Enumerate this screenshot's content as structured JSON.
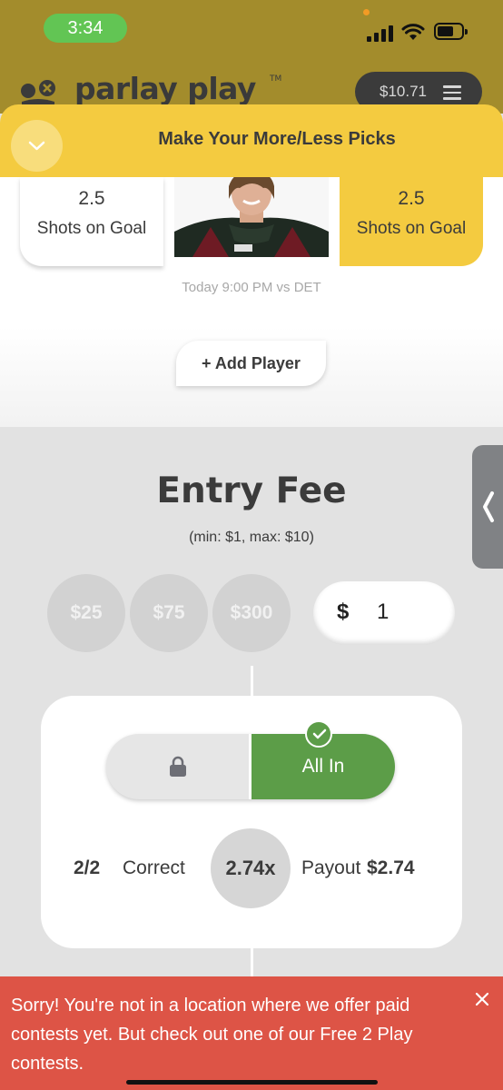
{
  "status_bar": {
    "time": "3:34"
  },
  "header": {
    "logo_text": "parlay play",
    "logo_tm": "TM",
    "balance": "$10.71"
  },
  "sheet": {
    "title": "Make Your More/Less Picks"
  },
  "pick": {
    "less_card": {
      "line": "2.5",
      "stat": "Shots on Goal"
    },
    "more_card": {
      "line": "2.5",
      "stat": "Shots on Goal"
    },
    "game_time": "Today 9:00 PM vs DET",
    "add_player_label": "+ Add Player"
  },
  "entry": {
    "title": "Entry Fee",
    "range": "(min: $1, max: $10)",
    "presets": [
      "$25",
      "$75",
      "$300"
    ],
    "currency_symbol": "$",
    "amount": "1"
  },
  "result": {
    "mode_label": "All In",
    "correct_count": "2/2",
    "correct_label": "Correct",
    "multiplier": "2.74x",
    "payout_label": "Payout",
    "payout_value": "$2.74"
  },
  "error": {
    "message": "Sorry! You're not in a location where we offer paid contests yet. But check out one of our Free 2 Play contests."
  },
  "colors": {
    "header_bg": "#a38c2c",
    "accent_yellow": "#f4cb40",
    "success_green": "#5c9d48",
    "error_red": "#dd5446"
  }
}
